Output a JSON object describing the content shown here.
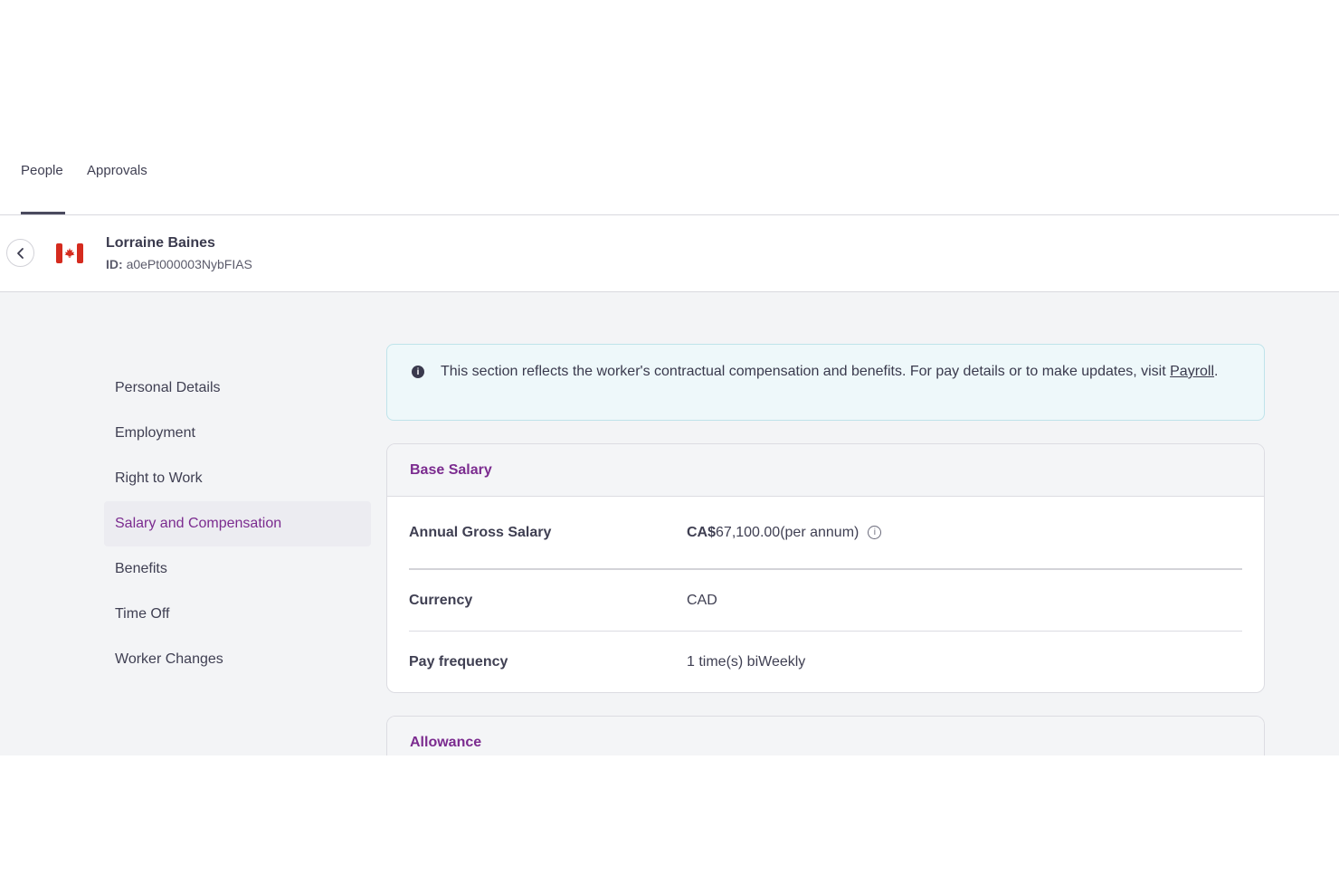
{
  "tabs": {
    "people": "People",
    "approvals": "Approvals"
  },
  "worker": {
    "name": "Lorraine Baines",
    "id_label": "ID:",
    "id_value": "a0ePt000003NybFIAS",
    "country_flag": "canada-flag-icon"
  },
  "nav": {
    "items": [
      {
        "label": "Personal Details"
      },
      {
        "label": "Employment"
      },
      {
        "label": "Right to Work"
      },
      {
        "label": "Salary and Compensation",
        "active": true
      },
      {
        "label": "Benefits"
      },
      {
        "label": "Time Off"
      },
      {
        "label": "Worker Changes"
      }
    ]
  },
  "banner": {
    "text": "This section reflects the worker's contractual compensation and benefits. For pay details or to make updates, visit",
    "link": "Payroll",
    "suffix": "."
  },
  "base_salary": {
    "title": "Base Salary",
    "rows": [
      {
        "label": "Annual Gross Salary",
        "currency_prefix": "CA$",
        "value": "67,100.00(per annum)"
      },
      {
        "label": "Currency",
        "value": "CAD"
      },
      {
        "label": "Pay frequency",
        "value": "1 time(s) biWeekly"
      }
    ]
  },
  "allowance": {
    "title": "Allowance"
  },
  "colors": {
    "accent": "#7b2b8f",
    "banner_bg": "#eef8fa",
    "content_bg": "#f3f4f6"
  }
}
